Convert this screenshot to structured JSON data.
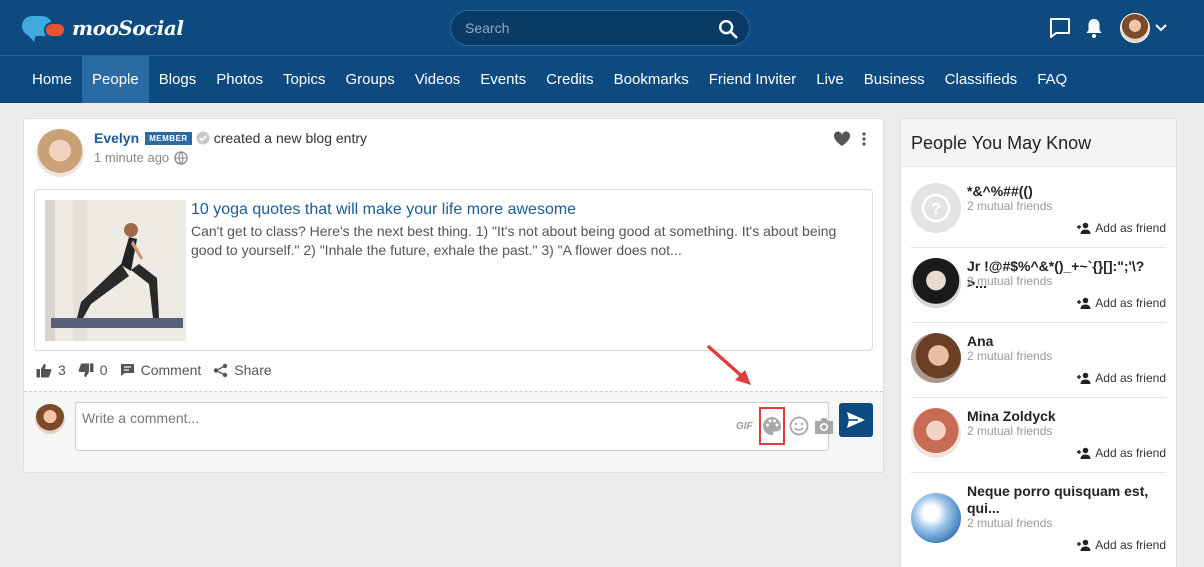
{
  "brand": {
    "name": "mooSocial"
  },
  "search": {
    "placeholder": "Search"
  },
  "nav": {
    "items": [
      "Home",
      "People",
      "Blogs",
      "Photos",
      "Topics",
      "Groups",
      "Videos",
      "Events",
      "Credits",
      "Bookmarks",
      "Friend Inviter",
      "Live",
      "Business",
      "Classifieds",
      "FAQ"
    ],
    "active": "People"
  },
  "post": {
    "author": "Evelyn",
    "badge": "MEMBER",
    "action": "created a new blog entry",
    "time": "1 minute ago",
    "blog": {
      "title": "10 yoga quotes that will make your life more awesome",
      "excerpt": "Can't get to class? Here's the next best thing. 1) \"It's not about being good at something. It's about being good to yourself.\" 2) \"Inhale the future, exhale the past.\" 3) \"A flower does not..."
    },
    "likes": "3",
    "dislikes": "0",
    "comment_label": "Comment",
    "share_label": "Share"
  },
  "comment": {
    "placeholder": "Write a comment...",
    "gif_label": "GIF"
  },
  "sidebar": {
    "title": "People You May Know",
    "add_label": "Add as friend",
    "people": [
      {
        "name": "*&^%##(()",
        "mutual": "2 mutual friends"
      },
      {
        "name": "Jr !@#$%^&*()_+~`{}[]:\";'\\?>...",
        "mutual": "2 mutual friends"
      },
      {
        "name": "Ana",
        "mutual": "2 mutual friends"
      },
      {
        "name": "Mina Zoldyck",
        "mutual": "2 mutual friends"
      },
      {
        "name": "Neque porro quisquam est, qui...",
        "mutual": "2 mutual friends"
      }
    ]
  },
  "colors": {
    "brand_blue": "#0c4a80",
    "nav_active": "#2a6ba3",
    "link_blue": "#1b5b96",
    "highlight_red": "#e23b3b"
  }
}
